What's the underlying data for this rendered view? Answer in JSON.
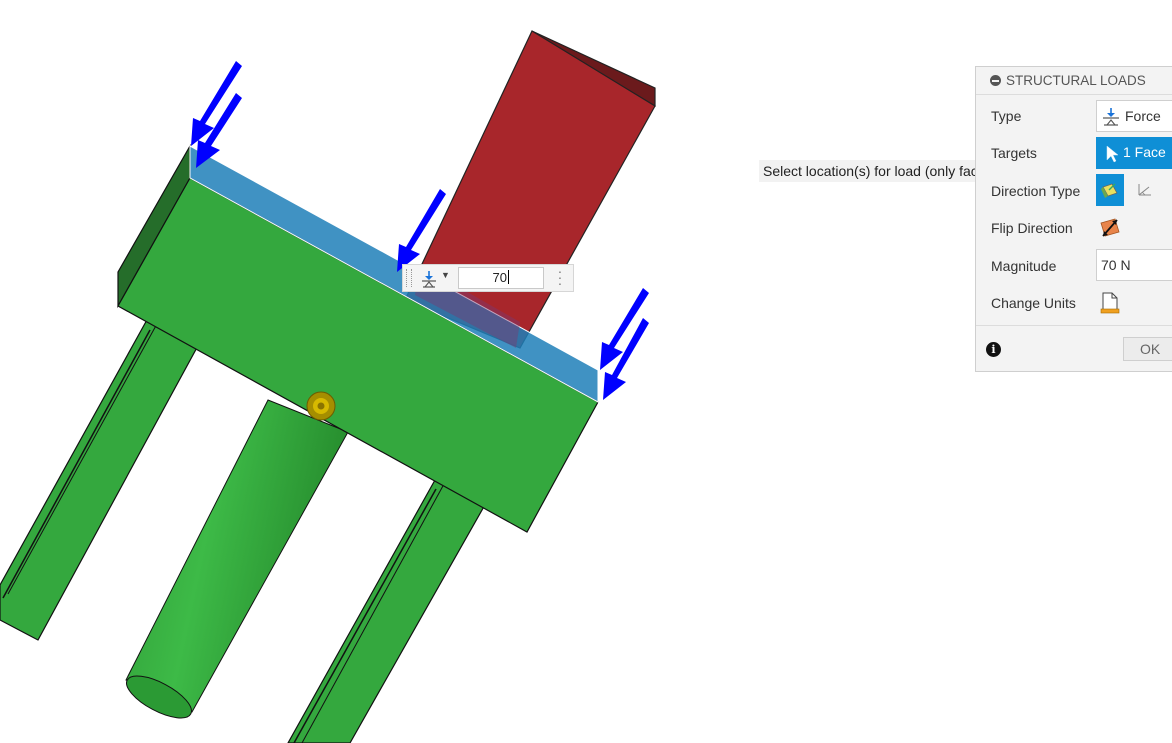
{
  "viewport": {
    "magnitude_input_value": "70",
    "load_type_icon": "force-load-icon",
    "more_icon": "vertical-ellipsis-icon"
  },
  "tooltip": {
    "text": "Select location(s) for load (only faces)."
  },
  "panel": {
    "title": "STRUCTURAL LOADS",
    "type": {
      "label": "Type",
      "value": "Force"
    },
    "targets": {
      "label": "Targets",
      "value": "1 Face"
    },
    "direction_type": {
      "label": "Direction Type"
    },
    "flip_direction": {
      "label": "Flip Direction"
    },
    "magnitude": {
      "label": "Magnitude",
      "value": "70 N"
    },
    "change_units": {
      "label": "Change Units"
    },
    "ok_label": "OK"
  },
  "colors": {
    "accent_blue": "#0f8fd6",
    "body_green": "#34a83e",
    "box_red": "#a8262b",
    "arrow_blue": "#0000ff"
  }
}
